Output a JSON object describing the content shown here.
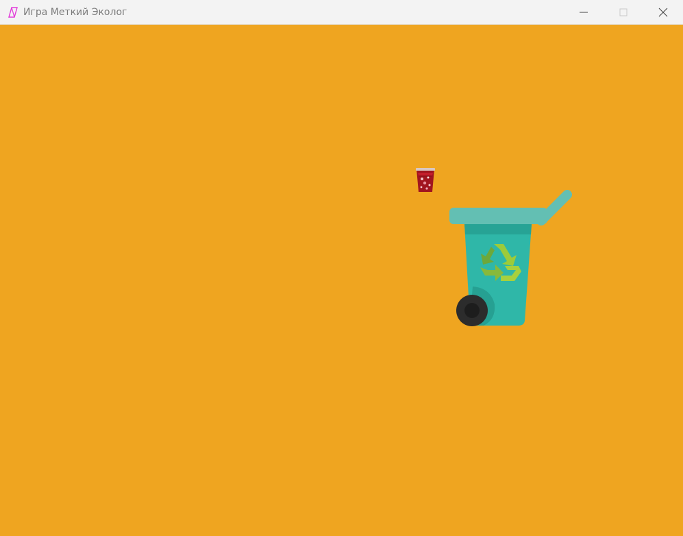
{
  "window": {
    "title": "Игра Меткий Эколог",
    "app_icon": "paint-app-icon",
    "controls": [
      "minimize-icon",
      "maximize-icon",
      "close-icon"
    ]
  },
  "game": {
    "background_color": "#efa520",
    "items": [
      {
        "name": "paper-cup",
        "icon": "paper-cup-icon"
      },
      {
        "name": "recycle-bin",
        "icon": "recycle-bin-icon"
      }
    ]
  }
}
